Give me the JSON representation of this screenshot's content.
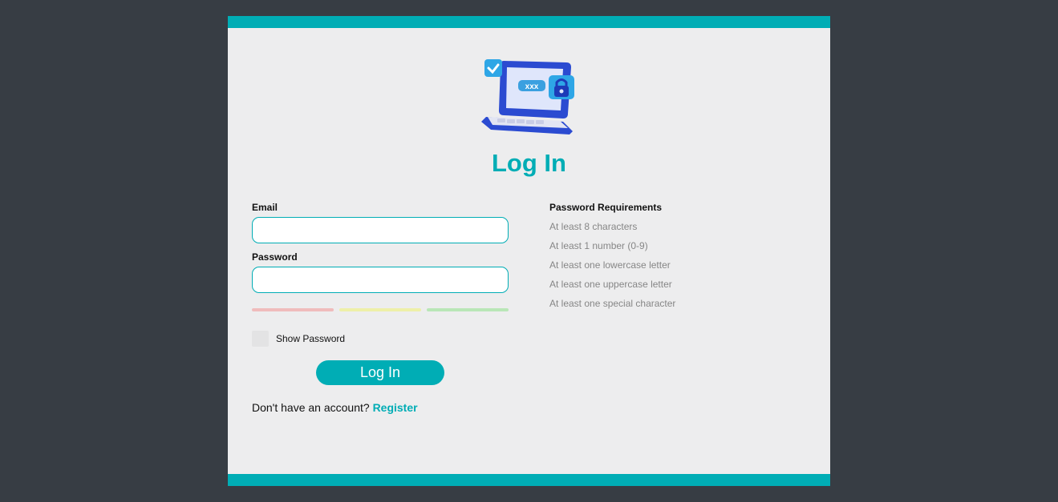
{
  "colors": {
    "page_background": "#373d44",
    "card_background": "#ededee",
    "accent": "#00adb5",
    "strength_weak": "#f0bcbc",
    "strength_medium": "#eef0a8",
    "strength_strong": "#b9e6b7"
  },
  "illustration": {
    "icon": "laptop-lock-icon",
    "screen_text": "xxx"
  },
  "title": "Log In",
  "form": {
    "email_label": "Email",
    "email_value": "",
    "password_label": "Password",
    "password_value": "",
    "show_password_label": "Show Password",
    "show_password_checked": false,
    "submit_label": "Log In",
    "register_prompt": "Don't have an account?",
    "register_link": "Register"
  },
  "requirements": {
    "title": "Password Requirements",
    "items": [
      "At least 8 characters",
      "At least 1 number (0-9)",
      "At least one lowercase letter",
      "At least one uppercase letter",
      "At least one special character"
    ]
  }
}
